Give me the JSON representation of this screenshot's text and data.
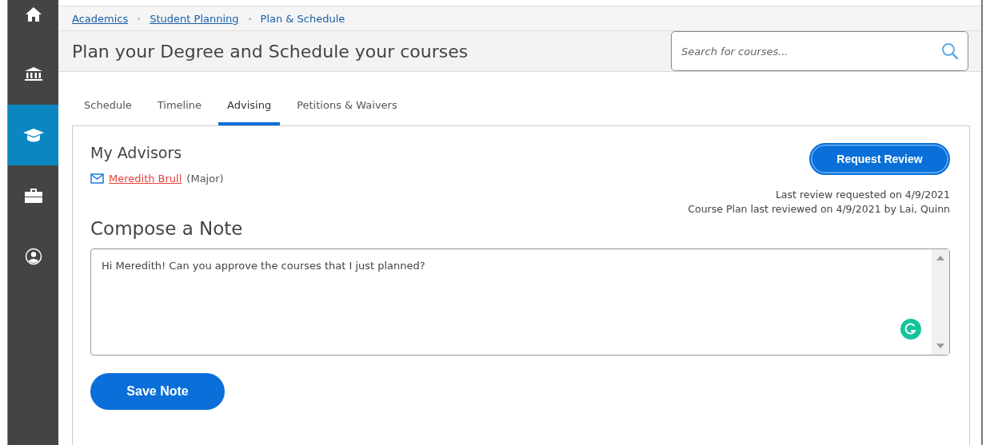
{
  "sidebar": {
    "items": [
      {
        "kind": "home",
        "selected": false
      },
      {
        "kind": "bank",
        "selected": false
      },
      {
        "kind": "cap",
        "selected": true
      },
      {
        "kind": "briefcase",
        "selected": false
      },
      {
        "kind": "user",
        "selected": false
      }
    ]
  },
  "breadcrumbs": [
    {
      "label": "Academics",
      "link": true
    },
    {
      "label": "Student Planning",
      "link": true
    },
    {
      "label": "Plan & Schedule",
      "link": false
    }
  ],
  "header": {
    "title": "Plan your Degree and Schedule your courses",
    "search": {
      "placeholder": "Search for courses..."
    }
  },
  "tabs": [
    {
      "label": "Schedule",
      "selected": false
    },
    {
      "label": "Timeline",
      "selected": false
    },
    {
      "label": "Advising",
      "selected": true
    },
    {
      "label": "Petitions & Waivers",
      "selected": false
    }
  ],
  "advisors": {
    "title": "My Advisors",
    "items": [
      {
        "name": "Meredith Brull",
        "role": "(Major)"
      }
    ]
  },
  "review": {
    "button": "Request Review",
    "lines": [
      "Last review requested on 4/9/2021",
      "Course Plan last reviewed on 4/9/2021 by Lai, Quinn"
    ]
  },
  "note": {
    "title": "Compose a Note",
    "value": "Hi Meredith! Can you approve the courses that I just planned?",
    "button": "Save Note"
  }
}
